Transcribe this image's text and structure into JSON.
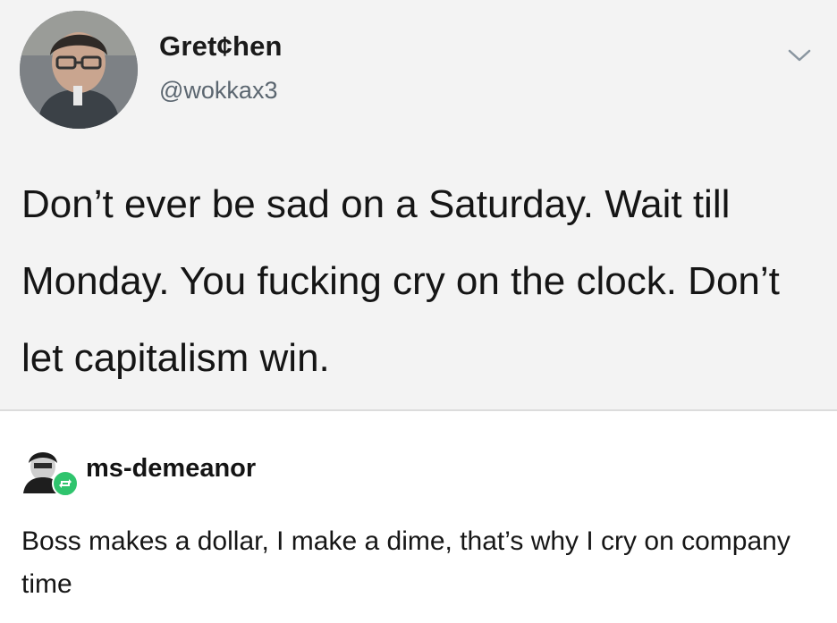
{
  "tweet": {
    "display_name": "Gret¢hen",
    "handle": "@wokkax3",
    "text": "Don’t ever be sad on a Saturday. Wait till Monday. You fucking cry on the clock. Don’t let capitalism win.",
    "menu_icon": "chevron-down-icon"
  },
  "reply": {
    "username": "ms-demeanor",
    "text": "Boss makes a dollar, I make a dime, that’s why I cry on company time",
    "badge_icon": "reblog-icon",
    "badge_color": "#2fc46d"
  }
}
